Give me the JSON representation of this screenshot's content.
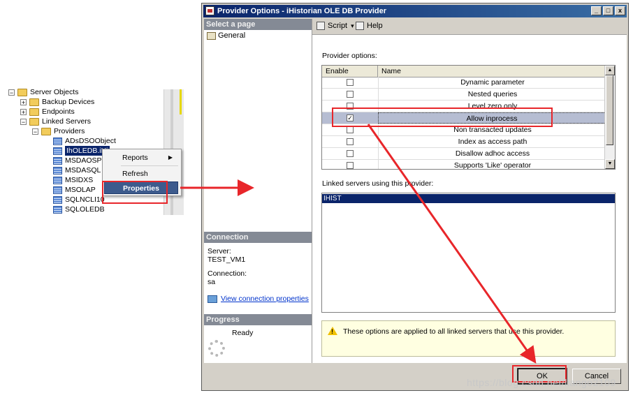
{
  "tree": {
    "items": [
      {
        "label": "Server Objects",
        "expander": "−"
      },
      {
        "label": "Backup Devices",
        "expander": "+"
      },
      {
        "label": "Endpoints",
        "expander": "+"
      },
      {
        "label": "Linked Servers",
        "expander": "−"
      },
      {
        "label": "Providers",
        "expander": "−"
      },
      {
        "label": "ADsDSOObject"
      },
      {
        "label": "IhOLEDB.iHi"
      },
      {
        "label": "MSDAOSP"
      },
      {
        "label": "MSDASQL"
      },
      {
        "label": "MSIDXS"
      },
      {
        "label": "MSOLAP"
      },
      {
        "label": "SQLNCLI10"
      },
      {
        "label": "SQLOLEDB"
      }
    ]
  },
  "context_menu": {
    "items": [
      "Reports",
      "Refresh",
      "Properties"
    ],
    "submenu_arrow": "▶"
  },
  "dialog": {
    "title": "Provider Options - iHistorian OLE DB Provider",
    "window_buttons": [
      "_",
      "□",
      "x"
    ],
    "select_page_header": "Select a page",
    "page_general": "General",
    "toolbar": {
      "script": "Script",
      "script_arrow": "▾",
      "help": "Help"
    },
    "provider_options_label": "Provider options:",
    "grid": {
      "col_enable": "Enable",
      "col_name": "Name",
      "rows": [
        {
          "name": "Dynamic parameter",
          "check": ""
        },
        {
          "name": "Nested queries",
          "check": ""
        },
        {
          "name": "Level zero only",
          "check": ""
        },
        {
          "name": "Allow inprocess",
          "check": "✓"
        },
        {
          "name": "Non transacted updates",
          "check": ""
        },
        {
          "name": "Index as access path",
          "check": ""
        },
        {
          "name": "Disallow adhoc access",
          "check": ""
        },
        {
          "name": "Supports 'Like' operator",
          "check": ""
        }
      ],
      "scroll_up": "▲",
      "scroll_down": "▼"
    },
    "linked_servers_label": "Linked servers using this provider:",
    "linked_servers": [
      "IHIST"
    ],
    "connection_header": "Connection",
    "server_label": "Server:",
    "server_value": "TEST_VM1",
    "connection_label": "Connection:",
    "connection_value": "sa",
    "view_connection_link": "View connection properties",
    "progress_header": "Progress",
    "progress_status": "Ready",
    "info_text": "These options are applied to all linked servers that use this provider.",
    "warning_mark": "!",
    "ok_label": "OK",
    "cancel_label": "Cancel"
  },
  "watermark": "https://blog.csdn.net/liango2109",
  "colors": {
    "annotation_red": "#e8262a",
    "selection_navy": "#0a246a"
  }
}
